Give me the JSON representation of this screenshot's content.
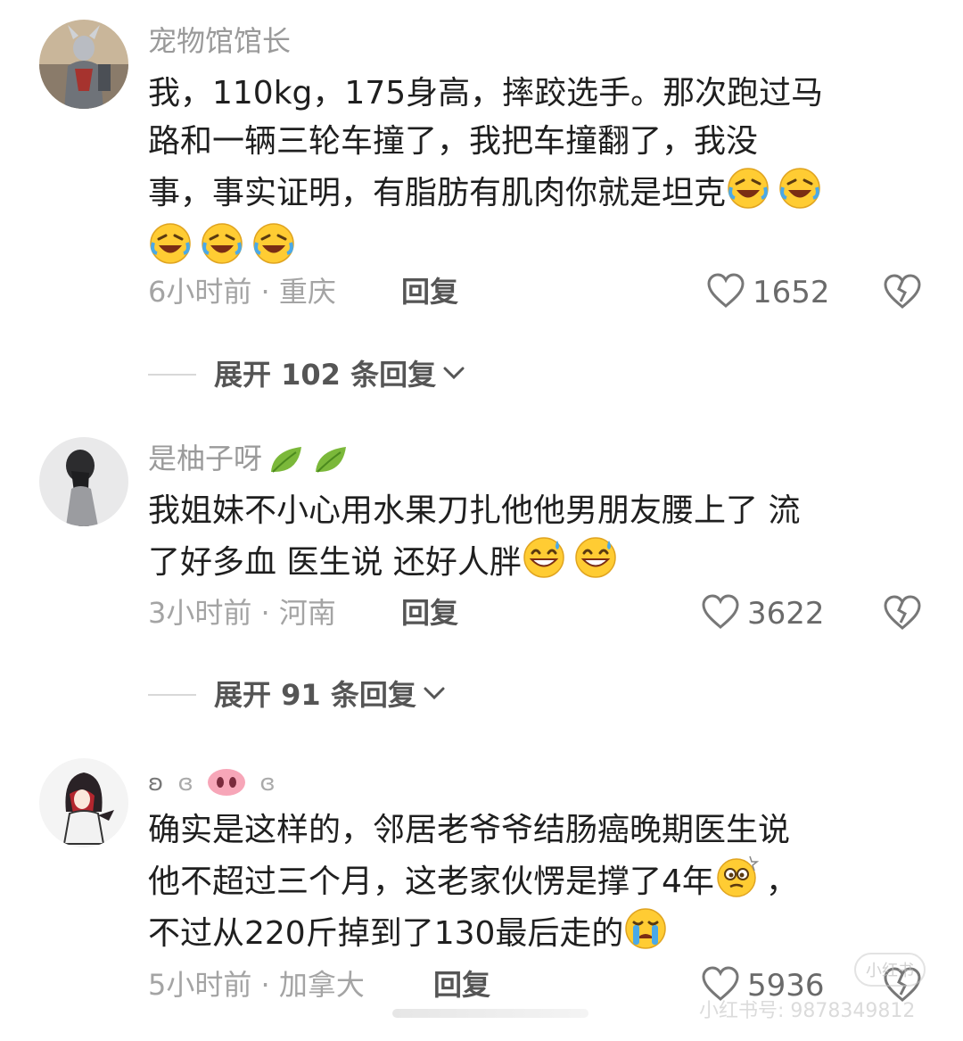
{
  "comments": [
    {
      "username": "宠物馆馆长",
      "lines": [
        "我，110kg，175身高，摔跤选手。那次跑过马",
        "路和一辆三轮车撞了，我把车撞翻了，我没",
        "事，事实证明，有脂肪有肌肉你就是坦克"
      ],
      "emoji": "rofl-emoji",
      "time_location": "6小时前 · 重庆",
      "reply_label": "回复",
      "likes": "1652",
      "expand_label": "展开 102 条回复"
    },
    {
      "username": "是柚子呀",
      "lines": [
        "我姐妹不小心用水果刀扎他他男朋友腰上了  流",
        "了好多血  医生说  还好人胖"
      ],
      "emoji": "sweat-smile-emoji",
      "time_location": "3小时前 · 河南",
      "reply_label": "回复",
      "likes": "3622",
      "expand_label": "展开 91 条回复"
    },
    {
      "username_parts": [
        "ʚ",
        "ɞ",
        "ɞ"
      ],
      "lines": [
        "确实是这样的，邻居老爷爷结肠癌晚期医生说",
        "他不超过三个月，这老家伙愣是撑了4年",
        "不过从220斤掉到了130最后走的"
      ],
      "line2_suffix": "，",
      "emoji": "dizzy-face-emoji",
      "emoji2": "crying-emoji",
      "time_location": "5小时前 · 加拿大",
      "reply_label": "回复",
      "likes": "5936"
    }
  ],
  "watermark": {
    "text": "小红书号: 9878349812",
    "logo": "小红书"
  },
  "colors": {
    "username": "#9a9a9a",
    "meta": "#a4a4a4",
    "text": "#1f1f1f",
    "emoji_yellow": "#ffcc33"
  }
}
